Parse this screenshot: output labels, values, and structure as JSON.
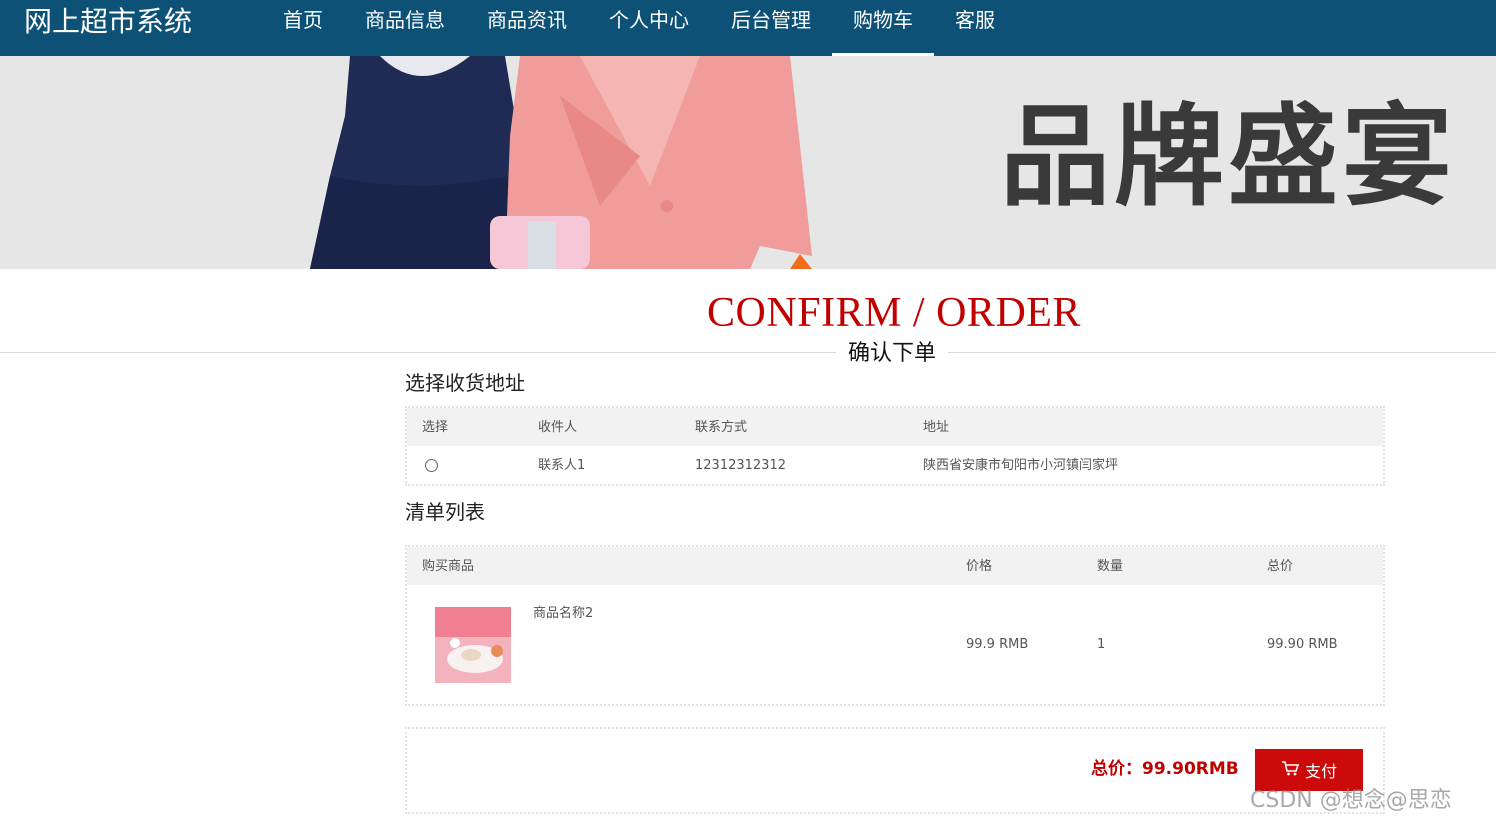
{
  "header": {
    "brand": "网上超市系统",
    "nav": [
      {
        "label": "首页"
      },
      {
        "label": "商品信息"
      },
      {
        "label": "商品资讯"
      },
      {
        "label": "个人中心"
      },
      {
        "label": "后台管理"
      },
      {
        "label": "购物车"
      },
      {
        "label": "客服"
      }
    ],
    "active": "购物车"
  },
  "banner": {
    "text": "品牌盛宴"
  },
  "page": {
    "title": "CONFIRM / ORDER",
    "subtitle": "确认下单"
  },
  "address": {
    "section_title": "选择收货地址",
    "columns": [
      "选择",
      "收件人",
      "联系方式",
      "地址"
    ],
    "rows": [
      {
        "selected": false,
        "recipient": "联系人1",
        "phone": "12312312312",
        "address": "陕西省安康市旬阳市小河镇闫家坪"
      }
    ]
  },
  "order": {
    "section_title": "清单列表",
    "columns": [
      "购买商品",
      "价格",
      "数量",
      "总价"
    ],
    "items": [
      {
        "name": "商品名称2",
        "price": "99.9 RMB",
        "quantity": "1",
        "total": "99.90 RMB"
      }
    ]
  },
  "summary": {
    "total_label": "总价：99.90RMB",
    "pay_label": "支付"
  },
  "watermark": "CSDN @想念@思恋",
  "colors": {
    "nav_bg": "#0d5177",
    "accent_red": "#c00000",
    "pay_button": "#cc0a0a"
  }
}
